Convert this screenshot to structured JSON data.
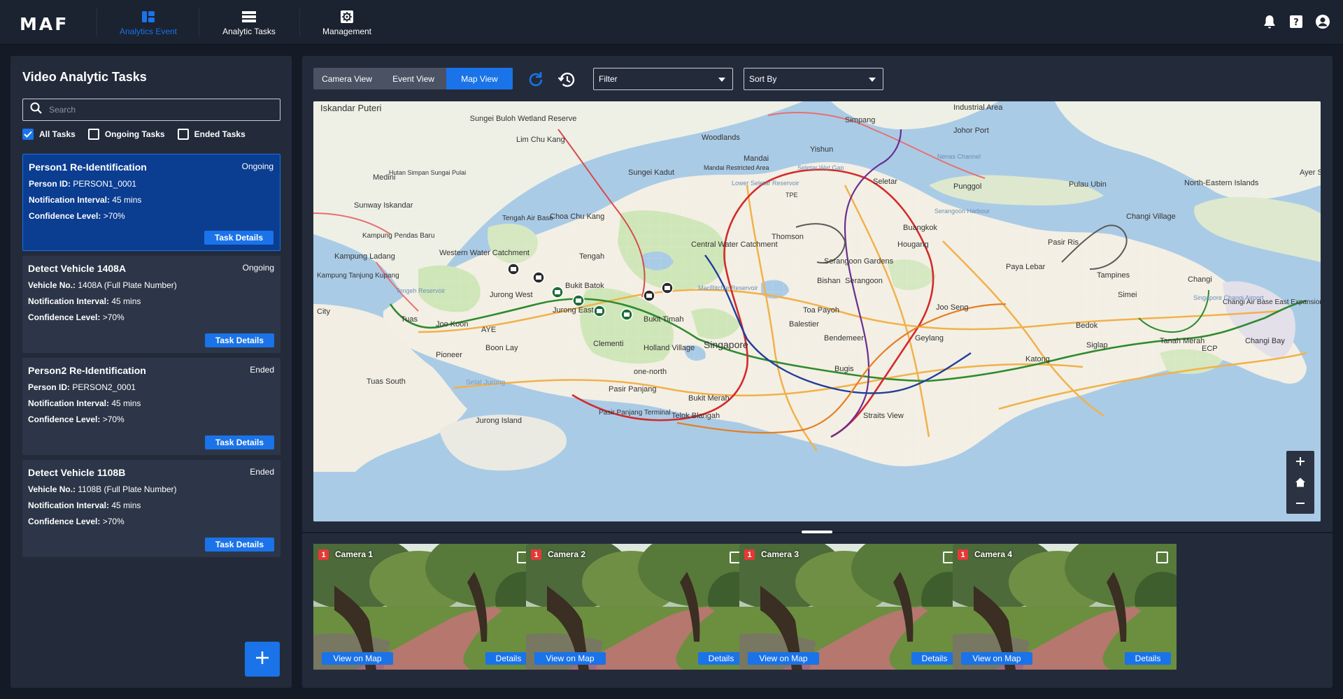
{
  "app": {
    "logo": "MAF"
  },
  "nav": {
    "items": [
      {
        "label": "Analytics Event",
        "icon": "dashboard-icon",
        "active": true
      },
      {
        "label": "Analytic Tasks",
        "icon": "list-icon",
        "active": false
      },
      {
        "label": "Management",
        "icon": "settings-icon",
        "active": false
      }
    ]
  },
  "top_icons": [
    "bell-icon",
    "help-icon",
    "account-icon"
  ],
  "sidebar": {
    "title": "Video Analytic Tasks",
    "search_placeholder": "Search",
    "filters": [
      {
        "label": "All Tasks",
        "checked": true
      },
      {
        "label": "Ongoing Tasks",
        "checked": false
      },
      {
        "label": "Ended Tasks",
        "checked": false
      }
    ],
    "tasks": [
      {
        "title": "Person1 Re-Identification",
        "status": "Ongoing",
        "selected": true,
        "rows": [
          {
            "label": "Person ID:",
            "value": "PERSON1_0001"
          },
          {
            "label": "Notification Interval:",
            "value": "45 mins"
          },
          {
            "label": "Confidence Level:",
            "value": ">70%"
          }
        ],
        "button": "Task Details"
      },
      {
        "title": "Detect Vehicle 1408A",
        "status": "Ongoing",
        "selected": false,
        "rows": [
          {
            "label": "Vehicle No.:",
            "value": "1408A (Full Plate Number)"
          },
          {
            "label": "Notification Interval:",
            "value": "45 mins"
          },
          {
            "label": "Confidence Level:",
            "value": ">70%"
          }
        ],
        "button": "Task Details"
      },
      {
        "title": "Person2 Re-Identification",
        "status": "Ended",
        "selected": false,
        "rows": [
          {
            "label": "Person ID:",
            "value": "PERSON2_0001"
          },
          {
            "label": "Notification Interval:",
            "value": "45 mins"
          },
          {
            "label": "Confidence Level:",
            "value": ">70%"
          }
        ],
        "button": "Task Details"
      },
      {
        "title": "Detect Vehicle 1108B",
        "status": "Ended",
        "selected": false,
        "rows": [
          {
            "label": "Vehicle No.:",
            "value": "1108B (Full Plate Number)"
          },
          {
            "label": "Notification Interval:",
            "value": "45 mins"
          },
          {
            "label": "Confidence Level:",
            "value": ">70%"
          }
        ],
        "button": "Task Details"
      }
    ],
    "add_button_icon": "plus-icon"
  },
  "main": {
    "views": [
      {
        "label": "Camera View",
        "active": false
      },
      {
        "label": "Event View",
        "active": false
      },
      {
        "label": "Map View",
        "active": true
      }
    ],
    "filter_label": "Filter",
    "sort_label": "Sort By",
    "map": {
      "labels": [
        "Iskandar Puteri",
        "Sungei Buloh Wetland Reserve",
        "Woodlands",
        "Simpang",
        "Industrial Area",
        "Johor Port",
        "Lim Chu Kang",
        "Mandai",
        "Yishun",
        "Sungei Kadut",
        "Mandai Restricted Area",
        "Seletar",
        "Punggol",
        "Pulau Ubin",
        "North-Eastern Islands",
        "Ayer S",
        "Medini",
        "Hutan Simpan Sungai Pulai",
        "Sunway Iskandar",
        "Tengah Air Base",
        "Choa Chu Kang",
        "Buangkok",
        "Changi Village",
        "Kampung Pendas Baru",
        "Central Water Catchment",
        "Thomson",
        "Hougang",
        "Pasir Ris",
        "Kampung Ladang",
        "Western Water Catchment",
        "Tengah",
        "Serangoon Gardens",
        "Paya Lebar",
        "Tampines",
        "Changi",
        "Kampung Tanjung Kupang",
        "Bukit Batok",
        "Bishan",
        "Serangoon",
        "Simei",
        "Jurong West",
        "Toa Payoh",
        "Joo Seng",
        "Changi Air Base East Expansion",
        "City",
        "Jurong East",
        "Bukit Timah",
        "Balestier",
        "Bedok",
        "Tuas",
        "Joo Koon",
        "AYE",
        "Bendemeer",
        "Geylang",
        "Tanah Merah",
        "Changi Bay",
        "Clementi",
        "Holland Village",
        "Singapore",
        "Siglap",
        "ECP",
        "Boon Lay",
        "Pioneer",
        "one-north",
        "Bugis",
        "Katong",
        "Tuas South",
        "Selat Jurong",
        "Pasir Panjang",
        "Bukit Merah",
        "Pasir Panjang Terminal",
        "Telok Blangah",
        "Straits View",
        "Jurong Island",
        "Lower Seletar Reservoir",
        "Tengeh Reservoir",
        "MacRitchie Reservoir",
        "Seletar Wet Gap",
        "Nenas Channel",
        "Serangoon Harbour",
        "Singapore Changi Airport",
        "TPE"
      ],
      "controls": [
        "zoom-in-icon",
        "home-icon",
        "zoom-out-icon"
      ]
    },
    "cameras": [
      {
        "name": "Camera 1",
        "badge": "1",
        "view_btn": "View on Map",
        "details_btn": "Details"
      },
      {
        "name": "Camera 2",
        "badge": "1",
        "view_btn": "View on Map",
        "details_btn": "Details"
      },
      {
        "name": "Camera 3",
        "badge": "1",
        "view_btn": "View on Map",
        "details_btn": "Details"
      },
      {
        "name": "Camera 4",
        "badge": "1",
        "view_btn": "View on Map",
        "details_btn": "Details"
      }
    ]
  },
  "colors": {
    "accent": "#1a73e8",
    "background": "#151b26",
    "panel": "#232b3a",
    "card": "#2d3648",
    "badge": "#e53935"
  }
}
